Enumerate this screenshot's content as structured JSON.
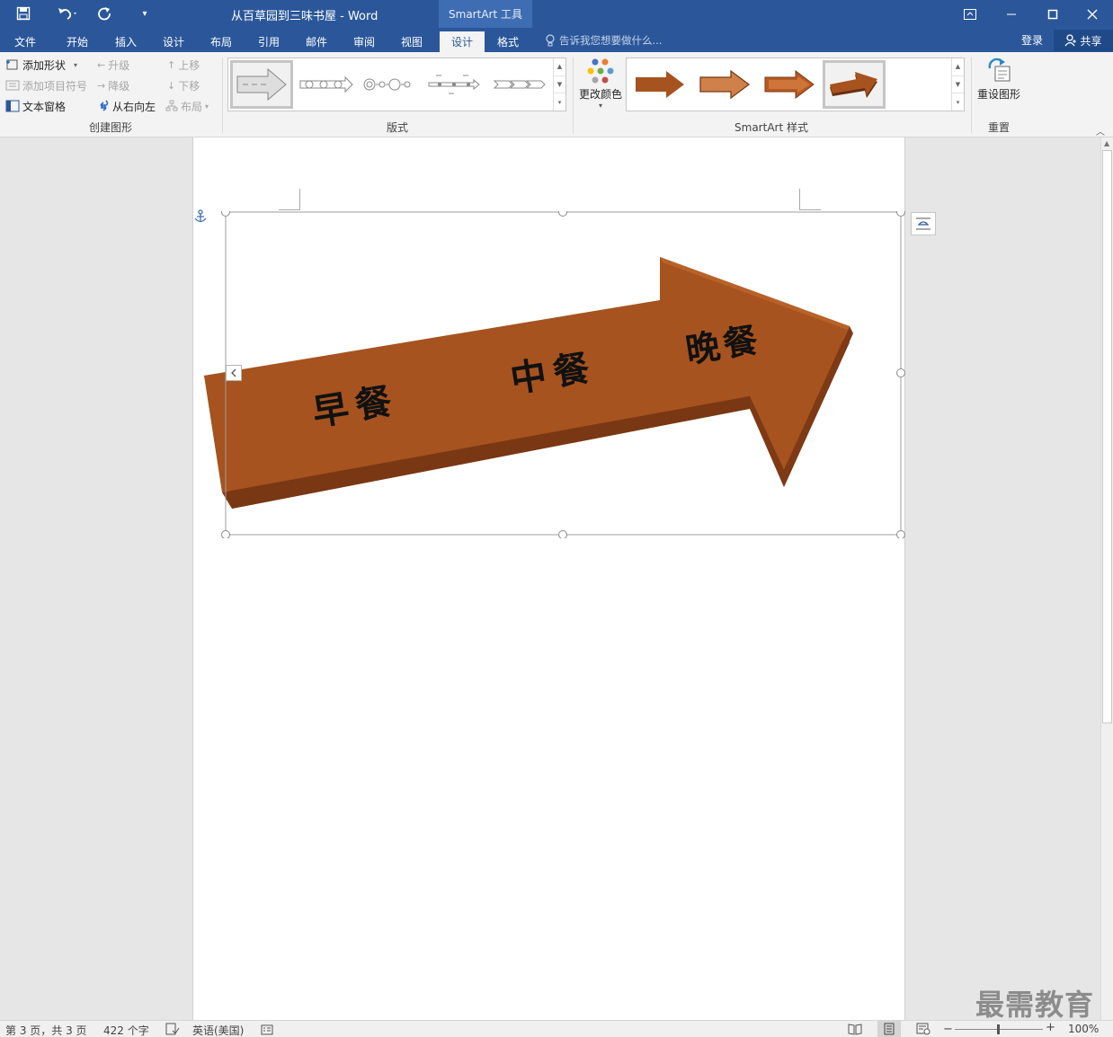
{
  "titlebar": {
    "document_title": "从百草园到三味书屋 - Word",
    "context_title": "SmartArt 工具"
  },
  "tabs": [
    "文件",
    "开始",
    "插入",
    "设计",
    "布局",
    "引用",
    "邮件",
    "审阅",
    "视图",
    "设计",
    "格式"
  ],
  "tell_me": "告诉我您想要做什么...",
  "account": {
    "login": "登录",
    "share": "共享"
  },
  "ribbon": {
    "create_graphic": {
      "add_shape": "添加形状",
      "add_bullet": "添加项目符号",
      "text_pane": "文本窗格",
      "promote": "升级",
      "demote": "降级",
      "right_to_left": "从右向左",
      "move_up": "上移",
      "move_down": "下移",
      "layout": "布局",
      "label": "创建图形"
    },
    "layouts": {
      "label": "版式"
    },
    "styles": {
      "change_colors": "更改颜色",
      "label": "SmartArt 样式"
    },
    "reset": {
      "reset_graphic": "重设图形",
      "label": "重置"
    }
  },
  "smartart": {
    "items": [
      "早餐",
      "中餐",
      "晚餐"
    ],
    "arrow_color": "#a6531f",
    "arrow_dark": "#6b2f0f"
  },
  "status": {
    "page": "第 3 页，共 3 页",
    "words": "422 个字",
    "language": "英语(美国)",
    "zoom": "100%"
  },
  "watermark": "最需教育"
}
